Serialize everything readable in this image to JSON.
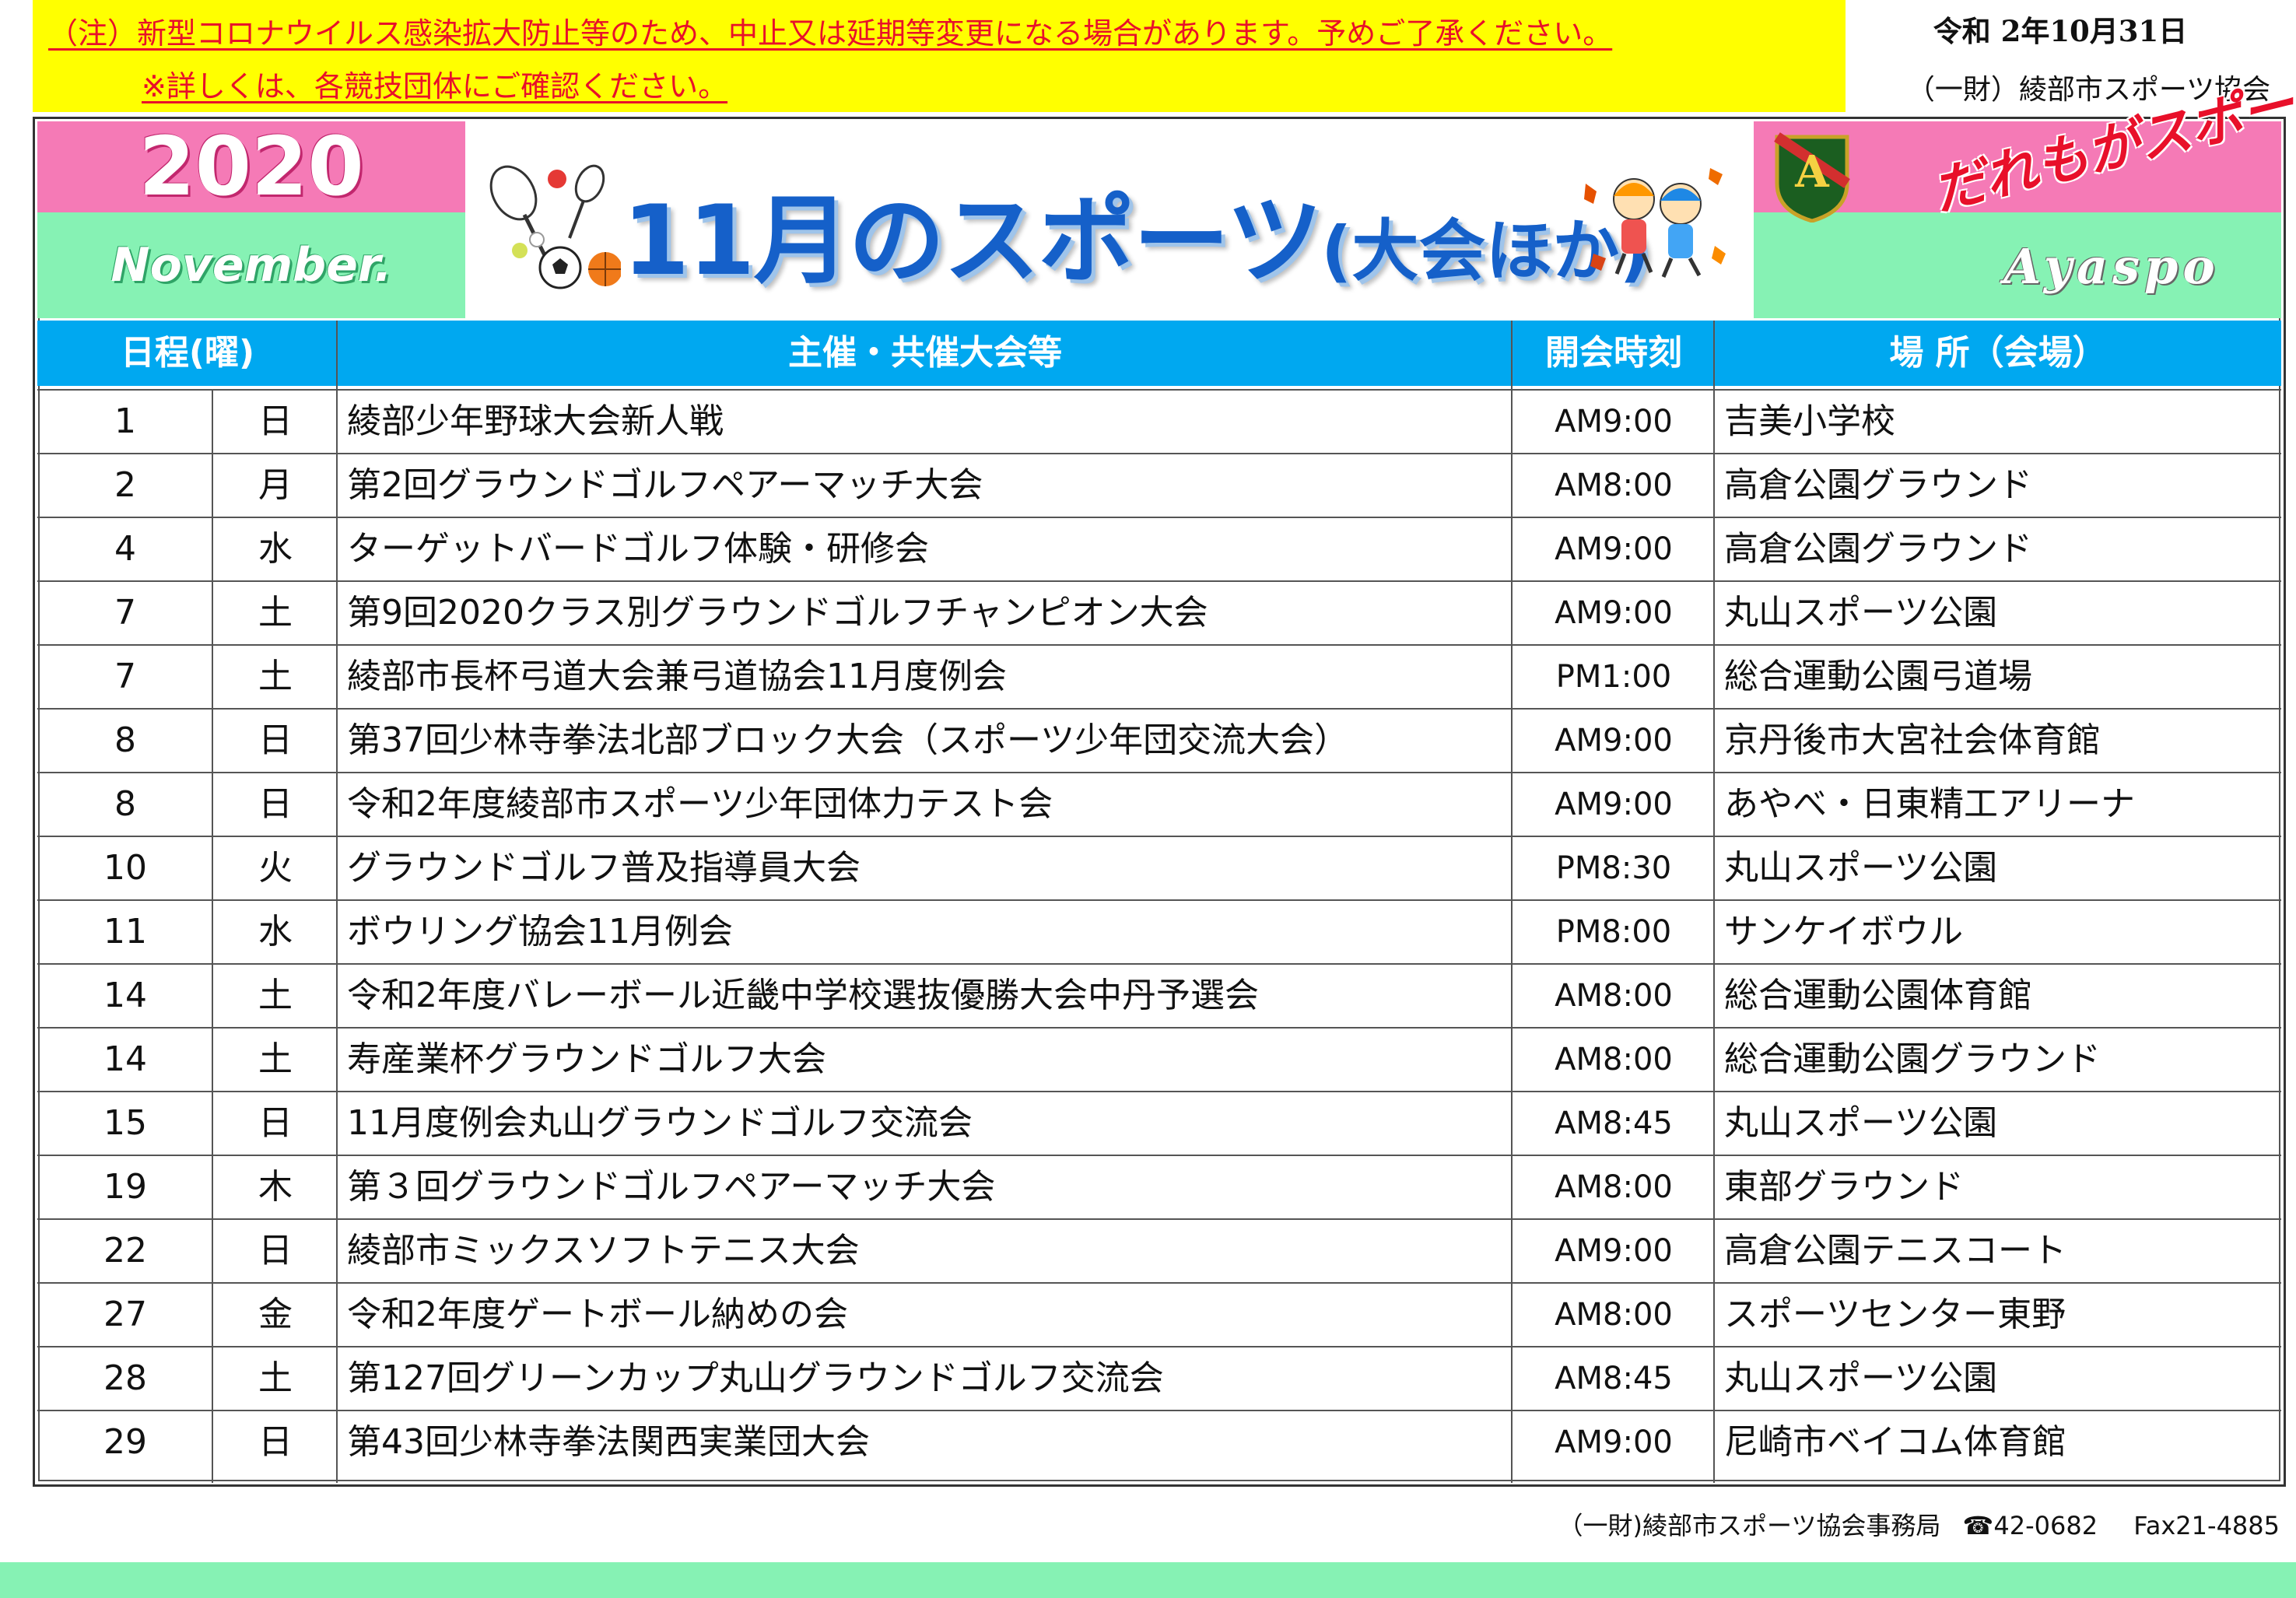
{
  "notice": {
    "line1": "（注）新型コロナウイルス感染拡大防止等のため、中止又は延期等変更になる場合があります。予めご了承ください。",
    "line2": "※詳しくは、各競技団体にご確認ください。"
  },
  "issue_date": "令和 2年10月31日",
  "organization": "（一財）綾部市スポーツ協会",
  "banner": {
    "year": "2020",
    "month_en": "November.",
    "title": "11月のスポーツ",
    "title_sub": "(大会ほか)",
    "slogan": "だれもがスポーツを！",
    "brand": "Ayaspo"
  },
  "table": {
    "headers": {
      "date": "日程(曜)",
      "event": "主催・共催大会等",
      "time": "開会時刻",
      "venue": "場 所（会場）"
    },
    "rows": [
      {
        "day": "1",
        "weekday": "日",
        "event": "綾部少年野球大会新人戦",
        "time": "AM9:00",
        "venue": "吉美小学校"
      },
      {
        "day": "2",
        "weekday": "月",
        "event": "第2回グラウンドゴルフペアーマッチ大会",
        "time": "AM8:00",
        "venue": "高倉公園グラウンド"
      },
      {
        "day": "4",
        "weekday": "水",
        "event": "ターゲットバードゴルフ体験・研修会",
        "time": "AM9:00",
        "venue": "高倉公園グラウンド"
      },
      {
        "day": "7",
        "weekday": "土",
        "event": "第9回2020クラス別グラウンドゴルフチャンピオン大会",
        "time": "AM9:00",
        "venue": "丸山スポーツ公園"
      },
      {
        "day": "7",
        "weekday": "土",
        "event": "綾部市長杯弓道大会兼弓道協会11月度例会",
        "time": "PM1:00",
        "venue": "総合運動公園弓道場"
      },
      {
        "day": "8",
        "weekday": "日",
        "event": "第37回少林寺拳法北部ブロック大会（スポーツ少年団交流大会）",
        "time": "AM9:00",
        "venue": "京丹後市大宮社会体育館"
      },
      {
        "day": "8",
        "weekday": "日",
        "event": "令和2年度綾部市スポーツ少年団体力テスト会",
        "time": "AM9:00",
        "venue": "あやべ・日東精工アリーナ"
      },
      {
        "day": "10",
        "weekday": "火",
        "event": "グラウンドゴルフ普及指導員大会",
        "time": "PM8:30",
        "venue": "丸山スポーツ公園"
      },
      {
        "day": "11",
        "weekday": "水",
        "event": "ボウリング協会11月例会",
        "time": "PM8:00",
        "venue": "サンケイボウル"
      },
      {
        "day": "14",
        "weekday": "土",
        "event": "令和2年度バレーボール近畿中学校選抜優勝大会中丹予選会",
        "time": "AM8:00",
        "venue": "総合運動公園体育館"
      },
      {
        "day": "14",
        "weekday": "土",
        "event": "寿産業杯グラウンドゴルフ大会",
        "time": "AM8:00",
        "venue": "総合運動公園グラウンド"
      },
      {
        "day": "15",
        "weekday": "日",
        "event": "11月度例会丸山グラウンドゴルフ交流会",
        "time": "AM8:45",
        "venue": "丸山スポーツ公園"
      },
      {
        "day": "19",
        "weekday": "木",
        "event": "第３回グラウンドゴルフペアーマッチ大会",
        "time": "AM8:00",
        "venue": "東部グラウンド"
      },
      {
        "day": "22",
        "weekday": "日",
        "event": "綾部市ミックスソフトテニス大会",
        "time": "AM9:00",
        "venue": "高倉公園テニスコート"
      },
      {
        "day": "27",
        "weekday": "金",
        "event": "令和2年度ゲートボール納めの会",
        "time": "AM8:00",
        "venue": "スポーツセンター東野"
      },
      {
        "day": "28",
        "weekday": "土",
        "event": "第127回グリーンカップ丸山グラウンドゴルフ交流会",
        "time": "AM8:45",
        "venue": "丸山スポーツ公園"
      },
      {
        "day": "29",
        "weekday": "日",
        "event": "第43回少林寺拳法関西実業団大会",
        "time": "AM9:00",
        "venue": "尼崎市ベイコム体育館"
      }
    ]
  },
  "footer": {
    "office": "（一財)綾部市スポーツ協会事務局",
    "phone_icon": "phone-icon",
    "phone": "42-0682",
    "fax": "Fax21-4885"
  },
  "colors": {
    "pink": "#f57ab6",
    "mint": "#86f2b4",
    "header_blue": "#00a8f0",
    "title_blue": "#1560c9",
    "notice_yellow": "#ffff00",
    "notice_red": "#e8102a"
  }
}
